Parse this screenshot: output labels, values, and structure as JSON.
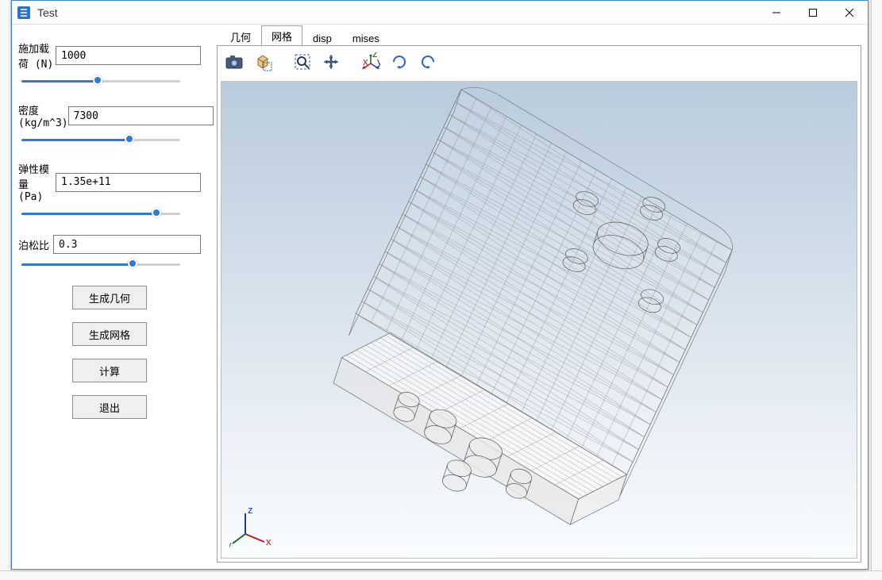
{
  "window": {
    "title": "Test"
  },
  "params": {
    "load": {
      "label": "施加载荷 (N)",
      "value": "1000",
      "fill_pct": 48
    },
    "density": {
      "label": "密度 (kg/m^3)",
      "value": "7300",
      "fill_pct": 68
    },
    "young": {
      "label": "弹性模量 (Pa)",
      "value": "1.35e+11",
      "fill_pct": 85
    },
    "poisson": {
      "label": "泊松比",
      "value": "0.3",
      "fill_pct": 70
    }
  },
  "buttons": {
    "gen_geom": "生成几何",
    "gen_mesh": "生成网格",
    "compute": "计算",
    "exit": "退出"
  },
  "tabs": {
    "items": [
      "几何",
      "网格",
      "disp",
      "mises"
    ],
    "active_index": 1
  },
  "toolbar_icons": [
    "camera-icon",
    "cube-select-icon",
    "zoom-box-icon",
    "pan-icon",
    "axes-icon",
    "rotate-cw-icon",
    "rotate-ccw-icon"
  ],
  "triad_axes": {
    "x": "x",
    "y": "y",
    "z": "z"
  }
}
